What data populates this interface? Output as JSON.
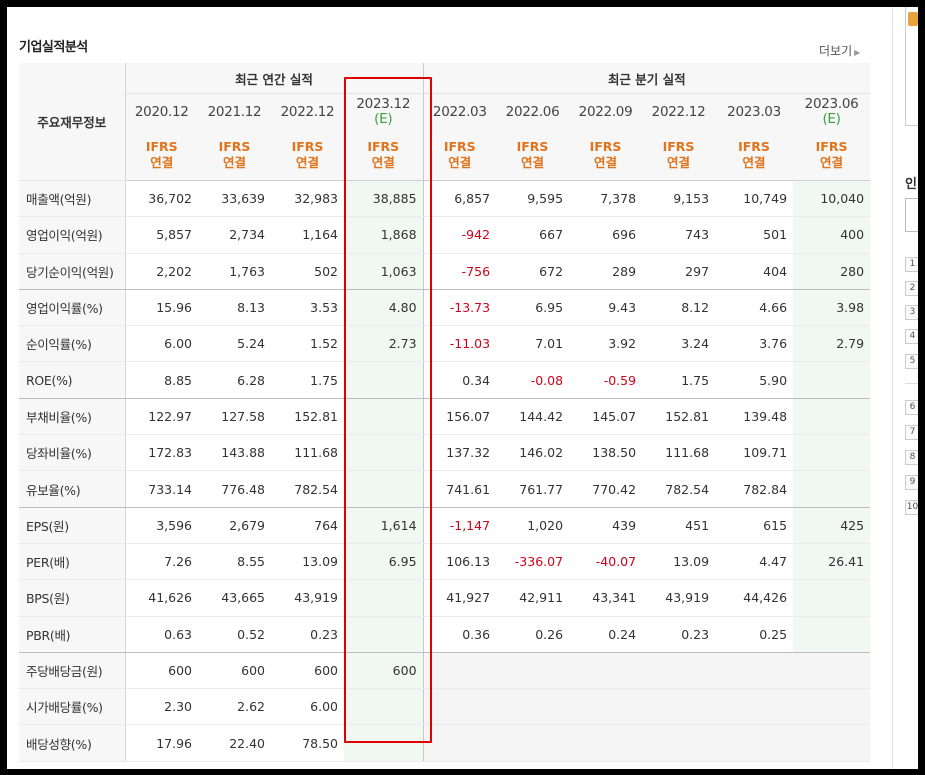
{
  "title": "기업실적분석",
  "more_label": "더보기",
  "row_header": "주요재무정보",
  "groups": {
    "annual": "최근 연간 실적",
    "quarterly": "최근 분기 실적"
  },
  "periods": [
    {
      "label": "2020.12",
      "est": ""
    },
    {
      "label": "2021.12",
      "est": ""
    },
    {
      "label": "2022.12",
      "est": ""
    },
    {
      "label": "2023.12",
      "est": "(E)"
    },
    {
      "label": "2022.03",
      "est": ""
    },
    {
      "label": "2022.06",
      "est": ""
    },
    {
      "label": "2022.09",
      "est": ""
    },
    {
      "label": "2022.12",
      "est": ""
    },
    {
      "label": "2023.03",
      "est": ""
    },
    {
      "label": "2023.06",
      "est": "(E)"
    }
  ],
  "ifrs": {
    "line1": "IFRS",
    "line2": "연결"
  },
  "rows": [
    {
      "label": "매출액(억원)",
      "values": [
        "36,702",
        "33,639",
        "32,983",
        "38,885",
        "6,857",
        "9,595",
        "7,378",
        "9,153",
        "10,749",
        "10,040"
      ]
    },
    {
      "label": "영업이익(억원)",
      "values": [
        "5,857",
        "2,734",
        "1,164",
        "1,868",
        "-942",
        "667",
        "696",
        "743",
        "501",
        "400"
      ]
    },
    {
      "label": "당기순이익(억원)",
      "values": [
        "2,202",
        "1,763",
        "502",
        "1,063",
        "-756",
        "672",
        "289",
        "297",
        "404",
        "280"
      ]
    },
    {
      "label": "영업이익률(%)",
      "values": [
        "15.96",
        "8.13",
        "3.53",
        "4.80",
        "-13.73",
        "6.95",
        "9.43",
        "8.12",
        "4.66",
        "3.98"
      ]
    },
    {
      "label": "순이익률(%)",
      "values": [
        "6.00",
        "5.24",
        "1.52",
        "2.73",
        "-11.03",
        "7.01",
        "3.92",
        "3.24",
        "3.76",
        "2.79"
      ]
    },
    {
      "label": "ROE(%)",
      "values": [
        "8.85",
        "6.28",
        "1.75",
        "",
        "0.34",
        "-0.08",
        "-0.59",
        "1.75",
        "5.90",
        ""
      ]
    },
    {
      "label": "부채비율(%)",
      "values": [
        "122.97",
        "127.58",
        "152.81",
        "",
        "156.07",
        "144.42",
        "145.07",
        "152.81",
        "139.48",
        ""
      ]
    },
    {
      "label": "당좌비율(%)",
      "values": [
        "172.83",
        "143.88",
        "111.68",
        "",
        "137.32",
        "146.02",
        "138.50",
        "111.68",
        "109.71",
        ""
      ]
    },
    {
      "label": "유보율(%)",
      "values": [
        "733.14",
        "776.48",
        "782.54",
        "",
        "741.61",
        "761.77",
        "770.42",
        "782.54",
        "782.84",
        ""
      ]
    },
    {
      "label": "EPS(원)",
      "values": [
        "3,596",
        "2,679",
        "764",
        "1,614",
        "-1,147",
        "1,020",
        "439",
        "451",
        "615",
        "425"
      ]
    },
    {
      "label": "PER(배)",
      "values": [
        "7.26",
        "8.55",
        "13.09",
        "6.95",
        "106.13",
        "-336.07",
        "-40.07",
        "13.09",
        "4.47",
        "26.41"
      ]
    },
    {
      "label": "BPS(원)",
      "values": [
        "41,626",
        "43,665",
        "43,919",
        "",
        "41,927",
        "42,911",
        "43,341",
        "43,919",
        "44,426",
        ""
      ]
    },
    {
      "label": "PBR(배)",
      "values": [
        "0.63",
        "0.52",
        "0.23",
        "",
        "0.36",
        "0.26",
        "0.24",
        "0.23",
        "0.25",
        ""
      ]
    },
    {
      "label": "주당배당금(원)",
      "values": [
        "600",
        "600",
        "600",
        "600",
        "",
        "",
        "",
        "",
        "",
        ""
      ]
    },
    {
      "label": "시가배당률(%)",
      "values": [
        "2.30",
        "2.62",
        "6.00",
        "",
        "",
        "",
        "",
        "",
        "",
        ""
      ]
    },
    {
      "label": "배당성향(%)",
      "values": [
        "17.96",
        "22.40",
        "78.50",
        "",
        "",
        "",
        "",
        "",
        "",
        ""
      ]
    }
  ],
  "right_panel": {
    "heading": "인",
    "numbers": [
      "1",
      "2",
      "3",
      "4",
      "5",
      "6",
      "7",
      "8",
      "9",
      "10"
    ]
  },
  "colors": {
    "negative": "#d0021b",
    "ifrs": "#e0731b",
    "estimate_bg": "#f1f8f1",
    "highlight": "#e00000"
  }
}
